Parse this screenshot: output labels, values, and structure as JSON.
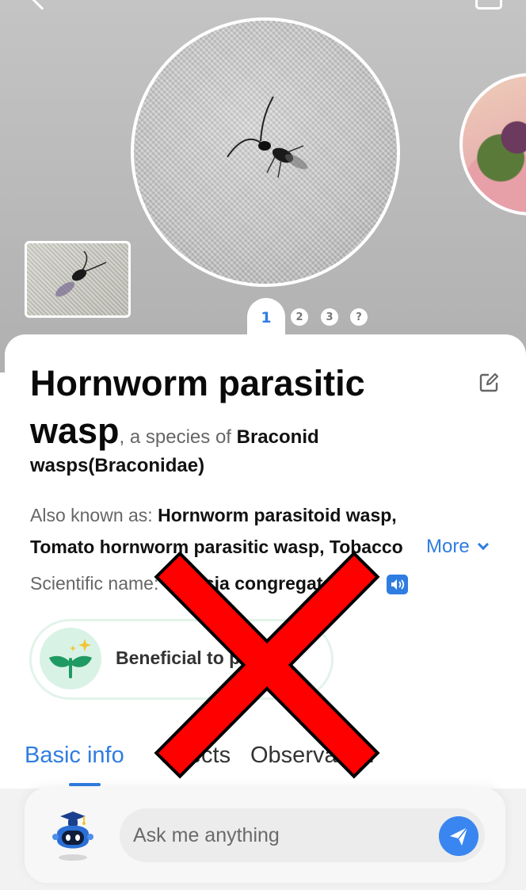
{
  "gallery": {
    "pager": {
      "active": "1",
      "others": [
        "2",
        "3",
        "?"
      ]
    }
  },
  "species": {
    "name_line1": "Hornworm parasitic",
    "name_line2": "wasp",
    "species_of_prefix": ", a species of ",
    "family_line1": "Braconid",
    "family_line2": "wasps(Braconidae)"
  },
  "aka": {
    "label": "Also known as: ",
    "name1": "Hornworm parasitoid wasp,",
    "line2": "Tomato hornworm parasitic wasp, Tobacco",
    "more_label": "More"
  },
  "scientific": {
    "label": "Scientific name: ",
    "value": "Cotesia congregata"
  },
  "benefit": {
    "label": "Beneficial to plants"
  },
  "tabs": [
    {
      "label": "Basic info"
    },
    {
      "label": "Effects"
    },
    {
      "label": "Observation"
    }
  ],
  "ask": {
    "placeholder": "Ask me anything"
  },
  "colors": {
    "accent": "#2f7de1",
    "overlay_x": "#ff0000"
  }
}
